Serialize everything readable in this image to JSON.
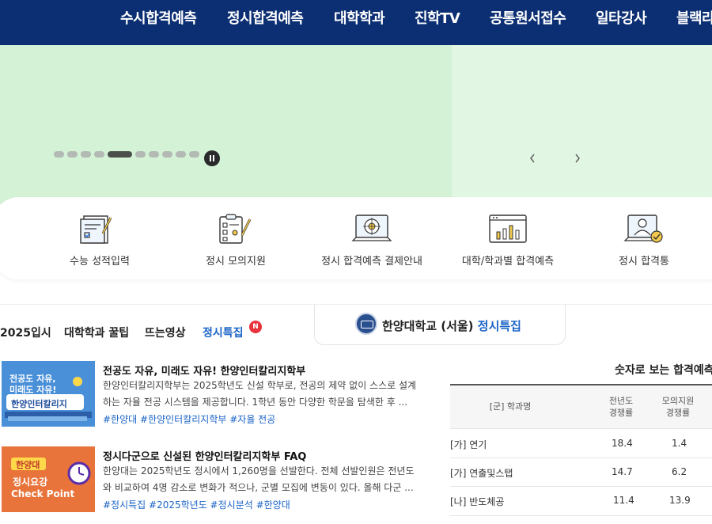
{
  "nav": {
    "items": [
      "수시합격예측",
      "정시합격예측",
      "대학학과",
      "진학TV",
      "공통원서접수",
      "일타강사",
      "블랙라벨"
    ]
  },
  "colors": {
    "nav_bg": "#0c2f73",
    "hero_left": "#d3f2d6",
    "hero_right": "#e2f7e3",
    "accent": "#1a63c7",
    "badge": "#e8323c"
  },
  "hero": {
    "slide_count": 11,
    "active_slide": 5,
    "prev_icon": "chevron-left-icon",
    "next_icon": "chevron-right-icon",
    "pause_icon": "pause-icon"
  },
  "quick_menu": [
    {
      "label": "수능 성적입력",
      "icon": "score-form-icon"
    },
    {
      "label": "정시 모의지원",
      "icon": "checklist-clipboard-icon"
    },
    {
      "label": "정시 합격예측 결제안내",
      "icon": "laptop-target-icon"
    },
    {
      "label": "대학/학과별 합격예측",
      "icon": "bar-chart-window-icon"
    },
    {
      "label": "정시 합격통",
      "icon": "user-check-icon"
    }
  ],
  "tabs": {
    "items": [
      "2025입시",
      "대학학과 꿀팁",
      "뜨는영상",
      "정시특집"
    ],
    "badge": "N"
  },
  "university": {
    "name": "한양대학교 (서울)",
    "accent": "정시특집"
  },
  "articles": [
    {
      "thumb_lines": [
        "전공도 자유,",
        "미래도 자유!",
        "한양인터칼리지"
      ],
      "title": "전공도 자유, 미래도 자유! 한양인터칼리지학부",
      "desc": "한양인터칼리지학부는 2025학년도 신설 학부로, 전공의 제약 없이 스스로 설계하는 자율 전공 시스템을 제공합니다. 1학년 동안 다양한 학문을 탐색한 후 ...",
      "tags": "#한양대 #한양인터칼리지학부 #자율 전공"
    },
    {
      "thumb_lines": [
        "한양대",
        "정시요강",
        "Check Point"
      ],
      "title": "정시다군으로 신설된 한양인터칼리지학부 FAQ",
      "desc": "한양대는 2025학년도 정시에서 1,260명을 선발한다. 전체 선발인원은 전년도와 비교하여 4명 감소로 변화가 적으나, 군별 모집에 변동이 있다. 올해 다군 ...",
      "tags": "#정시특집 #2025학년도 #정시분석 #한양대"
    }
  ],
  "stats_table": {
    "title": "숫자로 보는 합격예측",
    "headers": {
      "major": "[군] 학과명",
      "prev": [
        "전년도",
        "경쟁률"
      ],
      "mock": [
        "모의지원",
        "경쟁률"
      ]
    },
    "rows": [
      {
        "major": "[가] 연기",
        "prev": "18.4",
        "mock": "1.4"
      },
      {
        "major": "[가] 연출및스탭",
        "prev": "14.7",
        "mock": "6.2"
      },
      {
        "major": "[나] 반도체공",
        "prev": "11.4",
        "mock": "13.9"
      }
    ]
  }
}
